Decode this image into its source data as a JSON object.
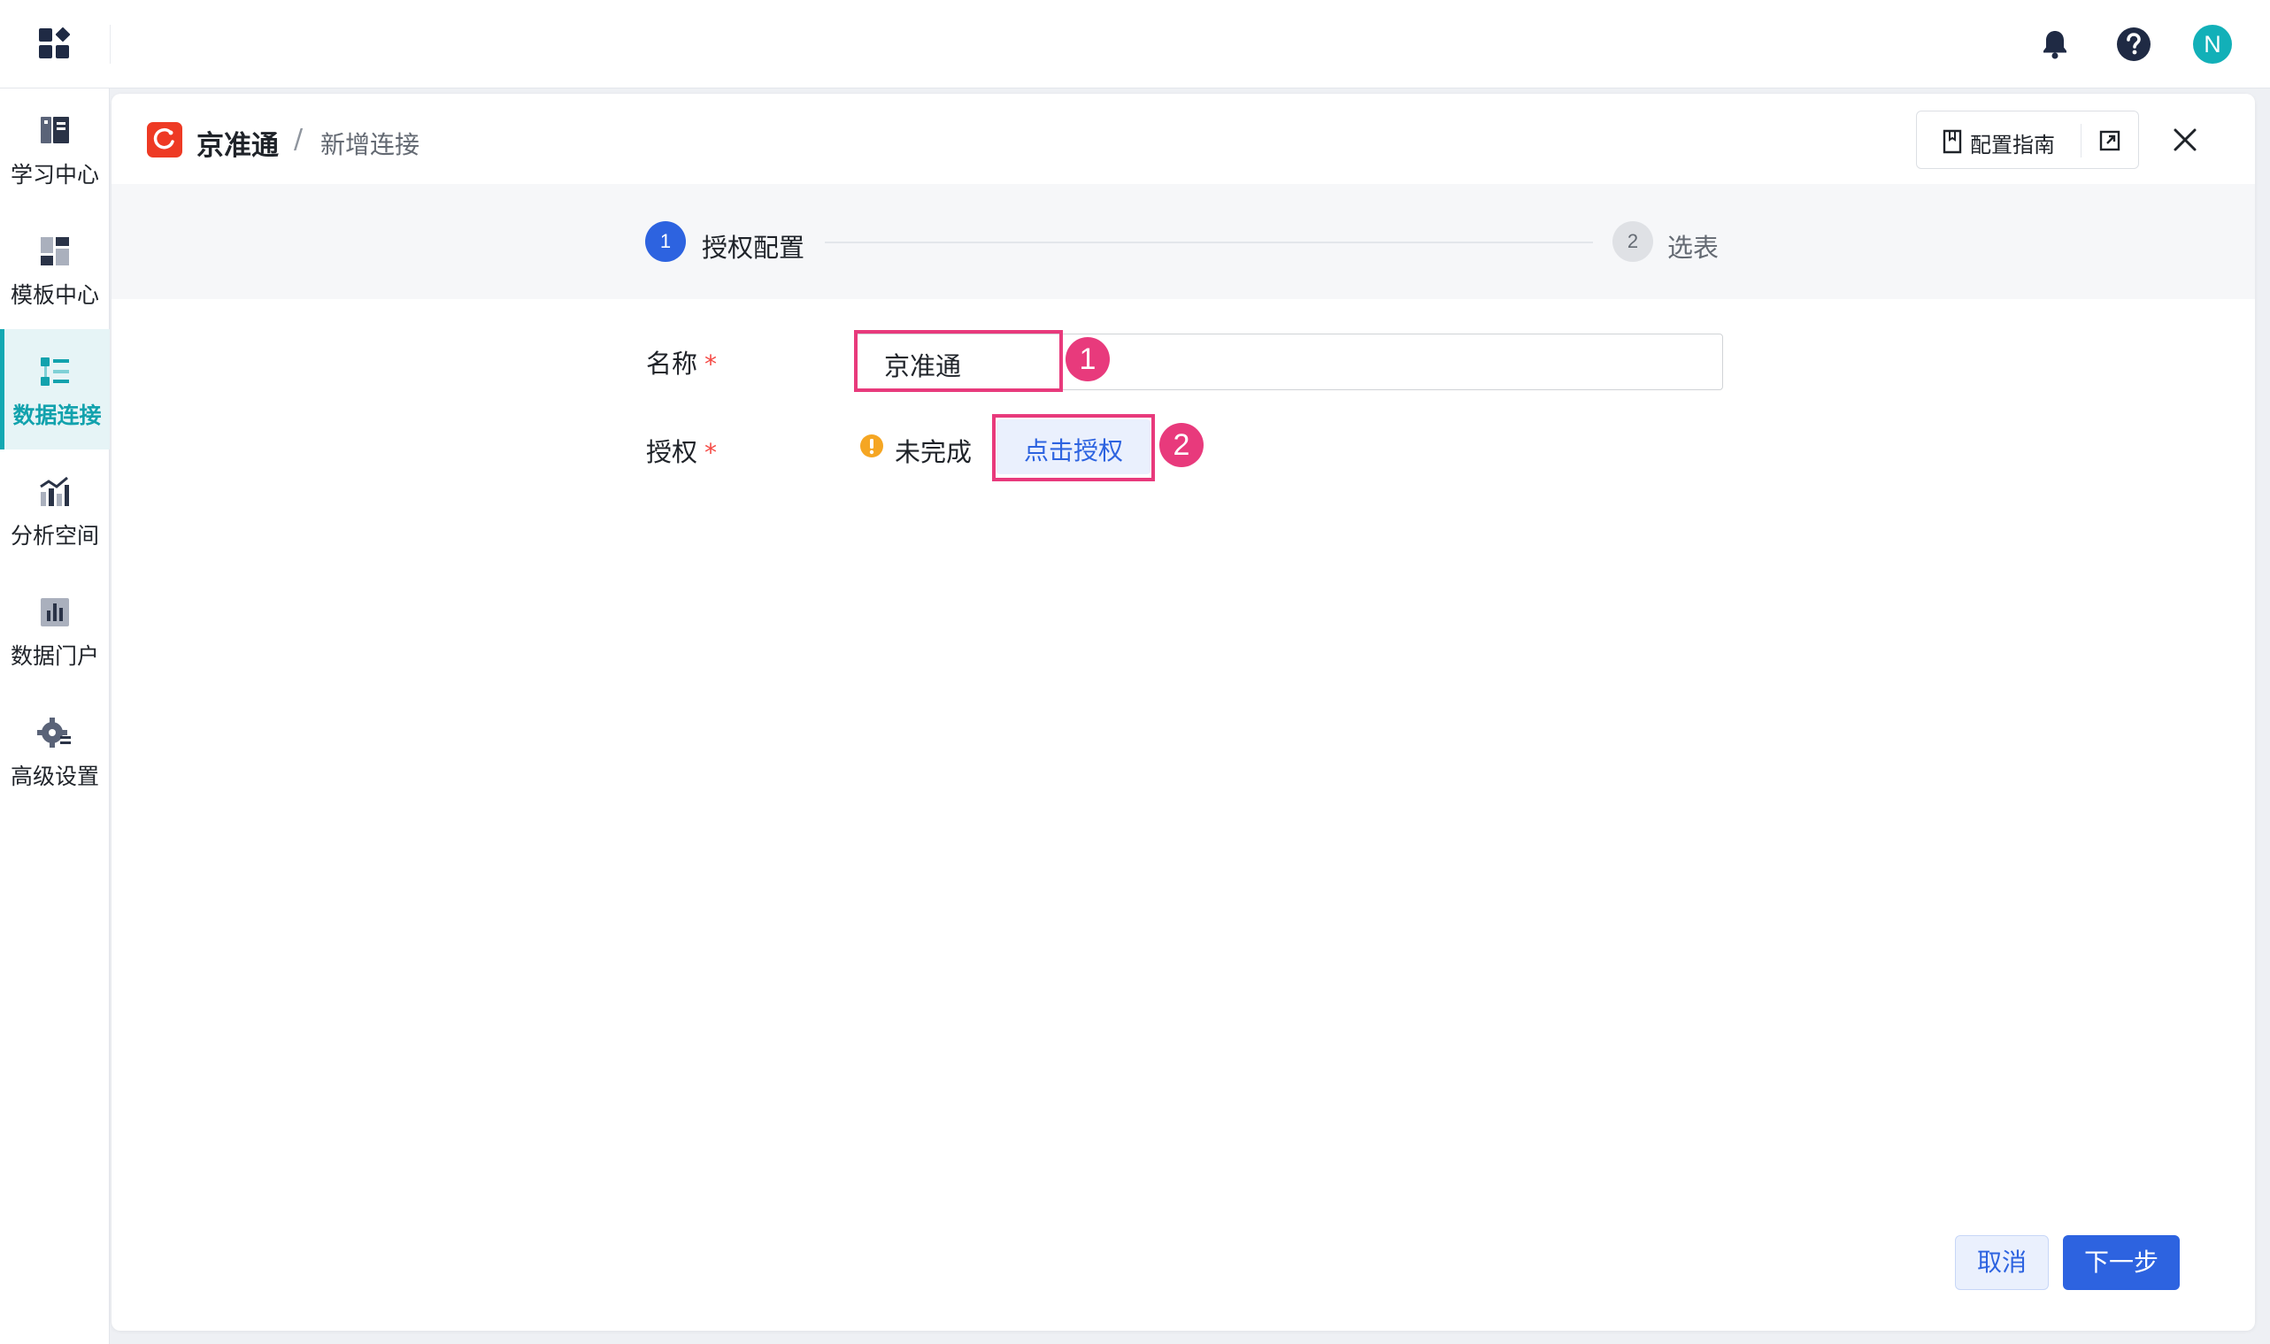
{
  "topbar": {
    "apps_icon": "grid-apps-icon",
    "notification_icon": "bell-icon",
    "help_icon": "help-circle-icon",
    "avatar_letter": "N",
    "avatar_color": "#12b0b8"
  },
  "sidebar": {
    "accent_color": "#13a8b2",
    "items": [
      {
        "label": "学习中心",
        "icon": "book-icon",
        "active": false
      },
      {
        "label": "模板中心",
        "icon": "template-icon",
        "active": false
      },
      {
        "label": "数据连接",
        "icon": "data-connection-icon",
        "active": true
      },
      {
        "label": "分析空间",
        "icon": "analysis-space-icon",
        "active": false
      },
      {
        "label": "数据门户",
        "icon": "bar-chart-icon",
        "active": false
      },
      {
        "label": "高级设置",
        "icon": "gear-icon",
        "active": false
      }
    ]
  },
  "header": {
    "brand_logo": "jingzhuntong-logo",
    "title": "京准通",
    "separator": "/",
    "subtitle": "新增连接",
    "guide_label": "配置指南",
    "guide_icon": "book-outline-icon",
    "popout_icon": "external-link-icon",
    "close_icon": "close-icon"
  },
  "steps": [
    {
      "number": "1",
      "label": "授权配置",
      "state": "active"
    },
    {
      "number": "2",
      "label": "选表",
      "state": "pending"
    }
  ],
  "form": {
    "name_label": "名称",
    "auth_label": "授权",
    "required_mark": "*",
    "name_value": "京准通",
    "auth_status": "未完成",
    "auth_status_icon": "warning-circle-icon",
    "auth_button": "点击授权"
  },
  "annotations": [
    {
      "number": "1",
      "color": "#e83a7c"
    },
    {
      "number": "2",
      "color": "#e83a7c"
    }
  ],
  "footer": {
    "cancel_label": "取消",
    "next_label": "下一步"
  },
  "colors": {
    "primary": "#2d63e0",
    "warning": "#f5a623",
    "required": "#f54a45",
    "brand_red": "#ee3a24"
  }
}
